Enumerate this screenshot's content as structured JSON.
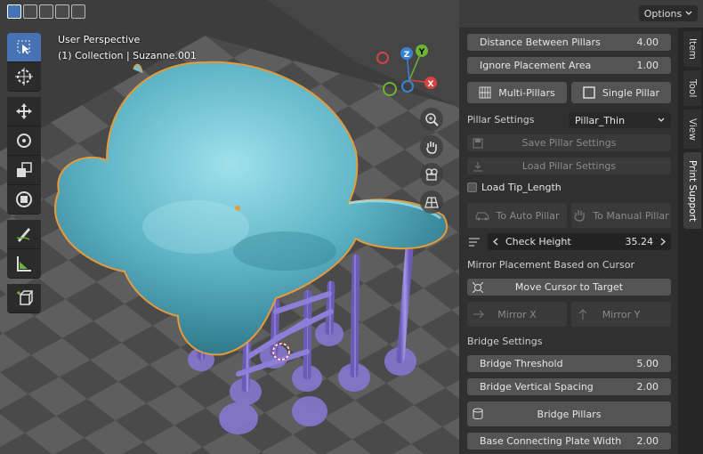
{
  "viewport": {
    "title": "User Perspective",
    "collection": "(1) Collection | Suzanne.001",
    "axes": {
      "z": "Z",
      "y": "Y",
      "x": "X"
    },
    "icons": [
      "select-box-icon",
      "cursor-icon",
      "move-icon",
      "rotate-icon",
      "scale-icon",
      "transform-icon",
      "annotate-icon",
      "measure-icon",
      "add-cube-icon"
    ]
  },
  "header": {
    "options_label": "Options"
  },
  "panel": {
    "distance_label": "Distance Between Pillars",
    "distance_value": "4.00",
    "ignore_label": "Ignore Placement Area",
    "ignore_value": "1.00",
    "multi_label": "Multi-Pillars",
    "single_label": "Single Pillar",
    "pillar_settings_label": "Pillar Settings",
    "pillar_settings_value": "Pillar_Thin",
    "save_label": "Save Pillar Settings",
    "load_label": "Load Pillar Settings",
    "tip_label": "Load Tip_Length",
    "auto_label": "To Auto Pillar",
    "manual_label": "To Manual Pillar",
    "check_label": "Check Height",
    "check_value": "35.24",
    "mirror_header": "Mirror Placement Based on Cursor",
    "move_cursor_label": "Move Cursor to Target",
    "mirror_x_label": "Mirror X",
    "mirror_y_label": "Mirror Y",
    "bridge_header": "Bridge Settings",
    "bridge_threshold_label": "Bridge Threshold",
    "bridge_threshold_value": "5.00",
    "bridge_spacing_label": "Bridge Vertical Spacing",
    "bridge_spacing_value": "2.00",
    "bridge_pillars_label": "Bridge Pillars",
    "base_plate_label": "Base Connecting Plate Width",
    "base_plate_value": "2.00"
  },
  "tabs": [
    "Item",
    "Tool",
    "View",
    "Print Support"
  ],
  "colors": {
    "accent": "#4772b3",
    "mesh": "#62b8c8",
    "outline": "#e59a3c",
    "pillar": "#8f7fd6"
  }
}
